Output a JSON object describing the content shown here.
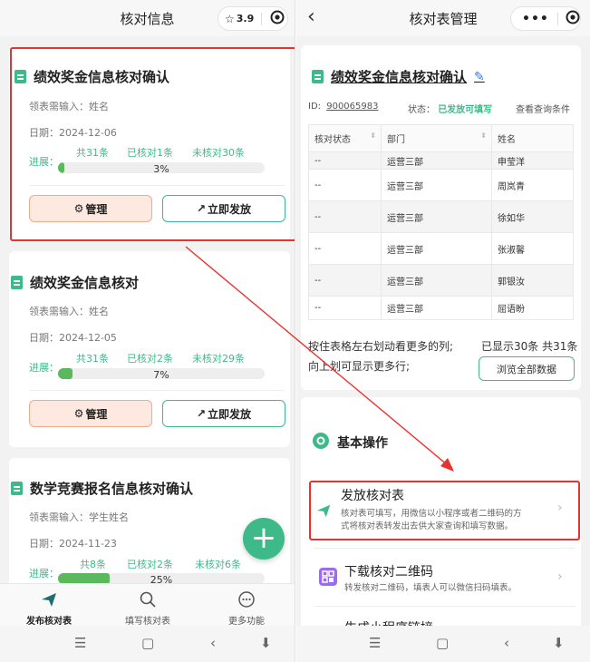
{
  "left": {
    "header": {
      "title": "核对信息",
      "stars": "3.9"
    },
    "cards": [
      {
        "title": "绩效奖金信息核对确认",
        "input_label": "领表需输入：姓名",
        "date": "日期：2024-12-06",
        "progress_label": "进展：",
        "total": "共31条",
        "checked": "已核对1条",
        "unchecked": "未核对30条",
        "progress": 3,
        "percent_text": "3%",
        "manage_label": "管理",
        "send_label": "立即发放"
      },
      {
        "title": "绩效奖金信息核对",
        "input_label": "领表需输入：姓名",
        "date": "日期：2024-12-05",
        "progress_label": "进展：",
        "total": "共31条",
        "checked": "已核对2条",
        "unchecked": "未核对29条",
        "progress": 7,
        "percent_text": "7%",
        "manage_label": "管理",
        "send_label": "立即发放"
      },
      {
        "title": "数学竞赛报名信息核对确认",
        "input_label": "领表需输入：学生姓名",
        "date": "日期：2024-11-23",
        "progress_label": "进展：",
        "total": "共8条",
        "checked": "已核对2条",
        "unchecked": "未核对6条",
        "progress": 25,
        "percent_text": "25%"
      }
    ],
    "fab_symbol": "+",
    "tabs": [
      {
        "label": "发布核对表",
        "icon": "paper-plane-icon"
      },
      {
        "label": "填写核对表",
        "icon": "search-icon"
      },
      {
        "label": "更多功能",
        "icon": "more-circle-icon"
      }
    ]
  },
  "right": {
    "header": {
      "title": "核对表管理"
    },
    "sheet": {
      "title": "绩效奖金信息核对确认",
      "id_label": "ID:",
      "id_value": "900065983",
      "status_label": "状态：",
      "status_value": "已发放可填写",
      "query_link": "查看查询条件",
      "columns": [
        "核对状态",
        "部门",
        "姓名"
      ],
      "rows": [
        [
          "--",
          "运营三部",
          "申莹洋"
        ],
        [
          "--",
          "运营三部",
          "周岚青"
        ],
        [
          "--",
          "运营三部",
          "徐如华"
        ],
        [
          "--",
          "运营三部",
          "张淑馨"
        ],
        [
          "--",
          "运营三部",
          "郭银汝"
        ],
        [
          "--",
          "运营三部",
          "屈语盼"
        ]
      ],
      "hint_line1": "按住表格左右划动看更多的列;",
      "hint_line2": "向上划可显示更多行;",
      "count_text": "已显示30条 共31条",
      "browse_all": "浏览全部数据"
    },
    "ops": {
      "section_title": "基本操作",
      "items": [
        {
          "title": "发放核对表",
          "desc_line1": "核对表可填写，用微信以小程序或者二维码的方",
          "desc_line2": "式将核对表转发出去供大家查询和填写数据。"
        },
        {
          "title": "下载核对二维码",
          "desc_line1": "转发核对二维码，填表人可以微信扫码填表。"
        },
        {
          "title": "生成小程序链接"
        }
      ]
    }
  },
  "colors": {
    "accent": "#3eba8a",
    "highlight": "#e8322d",
    "progress_fill": "#5cb85c",
    "manage_bg": "#fde9df"
  }
}
